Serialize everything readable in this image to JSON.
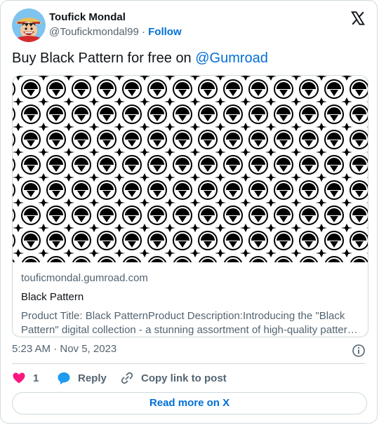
{
  "author": {
    "name": "Toufick Mondal",
    "handle": "@Toufickmondal99",
    "separator": "·",
    "follow_label": "Follow",
    "avatar_icon": "pirate-avatar-icon"
  },
  "tweet": {
    "text_prefix": "Buy Black Pattern for free on ",
    "mention": "@Gumroad"
  },
  "link_card": {
    "image_icon": "black-pattern-image",
    "domain": "touficmondal.gumroad.com",
    "title": "Black Pattern",
    "description": "Product Title: Black PatternProduct Description:Introducing the \"Black Pattern\" digital collection - a stunning assortment of high-quality patterns designed for every creative need."
  },
  "meta": {
    "timestamp": "5:23 AM · Nov 5, 2023"
  },
  "actions": {
    "like_count": "1",
    "reply_label": "Reply",
    "copy_label": "Copy link to post"
  },
  "read_more_label": "Read more on X",
  "colors": {
    "accent": "#006fd6",
    "like": "#f91880",
    "reply": "#1d9bf0",
    "muted": "#536471",
    "border": "#cfd9de"
  }
}
